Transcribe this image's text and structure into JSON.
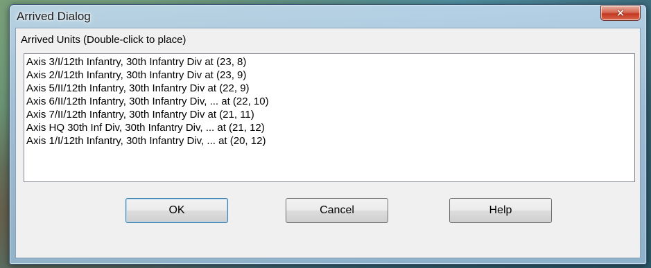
{
  "window": {
    "title": "Arrived Dialog",
    "close_glyph": "✕"
  },
  "group_label": "Arrived Units (Double-click to place)",
  "units": [
    "Axis 3/I/12th Infantry, 30th Infantry Div at (23, 8)",
    "Axis 2/I/12th Infantry, 30th Infantry Div at (23, 9)",
    "Axis 5/II/12th Infantry, 30th Infantry Div at (22, 9)",
    "Axis 6/II/12th Infantry, 30th Infantry Div, ... at (22, 10)",
    "Axis 7/II/12th Infantry, 30th Infantry Div at (21, 11)",
    "Axis HQ 30th Inf Div, 30th Infantry Div, ... at (21, 12)",
    "Axis 1/I/12th Infantry, 30th Infantry Div, ... at (20, 12)"
  ],
  "buttons": {
    "ok": "OK",
    "cancel": "Cancel",
    "help": "Help"
  }
}
